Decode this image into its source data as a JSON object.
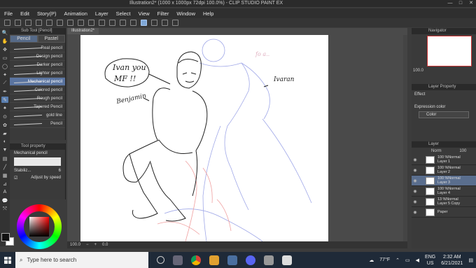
{
  "window": {
    "title": "Illustration2* (1000 x 1000px 72dpi 100.0%) - CLIP STUDIO PAINT EX",
    "controls": [
      "—",
      "□",
      "✕"
    ]
  },
  "menu": [
    "File",
    "Edit",
    "Story(P)",
    "Animation",
    "Layer",
    "Select",
    "View",
    "Filter",
    "Window",
    "Help"
  ],
  "subtool": {
    "header": "Sub Tool [Pencil]",
    "tabs": [
      "Pencil",
      "Pastel"
    ],
    "brushes": [
      "Real pencil",
      "Design pencil",
      "Darker pencil",
      "Lighter pencil",
      "Mechanical pencil",
      "Colored pencil",
      "Rough pencil",
      "Tapered Pencil",
      "gold line",
      "Pencil"
    ],
    "selected_index": 4
  },
  "tool_property": {
    "header": "Tool property",
    "name": "Mechanical pencil",
    "stabilization_label": "Stabiliz...",
    "stabilization_value": "6",
    "adjust_label": "Adjust by speed"
  },
  "document": {
    "tab": "Illustration2*",
    "status_zoom": "100.0",
    "status_angle": "0.0"
  },
  "drawing_text": {
    "speech_line1": "Ivan you",
    "speech_line2": "MF !!",
    "label_left": "Benjamin",
    "label_right": "Ivaran",
    "faint_text": "fo a.."
  },
  "navigator": {
    "header": "Navigator",
    "zoom": "100.0"
  },
  "layer_property": {
    "header": "Layer Property",
    "effect_label": "Effect",
    "expression_label": "Expression color",
    "expression_value": "Color"
  },
  "layers": {
    "header": "Layer",
    "blend": "Norm",
    "opacity": "100",
    "items": [
      {
        "line1": "100 %Normal",
        "line2": "Layer 1",
        "selected": false
      },
      {
        "line1": "100 %Normal",
        "line2": "Layer 2",
        "selected": false
      },
      {
        "line1": "100 %Normal",
        "line2": "Layer 3",
        "selected": true
      },
      {
        "line1": "100 %Normal",
        "line2": "Layer 4",
        "selected": false
      },
      {
        "line1": "13 %Normal",
        "line2": "Layer 5 Copy",
        "selected": false
      },
      {
        "line1": "Paper",
        "line2": "",
        "selected": false
      }
    ]
  },
  "taskbar": {
    "search_placeholder": "Type here to search",
    "weather": "77°F",
    "lang_line1": "ENG",
    "lang_line2": "US",
    "time": "2:32 AM",
    "date": "6/21/2021"
  },
  "colors": {
    "accent": "#5a74a0",
    "taskbar": "#1f2a38",
    "sketch_red": "#f0a0a0",
    "sketch_blue": "#a0a8e8"
  }
}
